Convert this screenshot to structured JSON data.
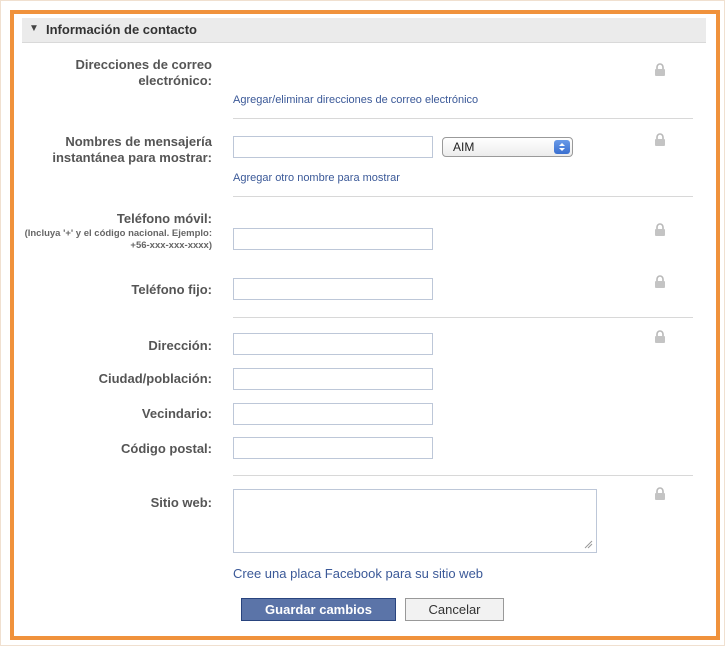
{
  "section": {
    "title": "Información de contacto"
  },
  "email": {
    "label": "Direcciones de correo electrónico:",
    "link": "Agregar/eliminar direcciones de correo electrónico"
  },
  "im": {
    "label": "Nombres de mensajería instantánea para mostrar:",
    "selected_service": "AIM",
    "link": "Agregar otro nombre para mostrar",
    "value": ""
  },
  "mobile": {
    "label": "Teléfono móvil:",
    "hint": "(Incluya '+' y el código nacional. Ejemplo: +56-xxx-xxx-xxxx)",
    "value": ""
  },
  "landline": {
    "label": "Teléfono fijo:",
    "value": ""
  },
  "address": {
    "label": "Dirección:",
    "value": ""
  },
  "city": {
    "label": "Ciudad/población:",
    "value": ""
  },
  "neighborhood": {
    "label": "Vecindario:",
    "value": ""
  },
  "zip": {
    "label": "Código postal:",
    "value": ""
  },
  "website": {
    "label": "Sitio web:",
    "link": "Cree una placa Facebook para su sitio web",
    "value": ""
  },
  "buttons": {
    "save": "Guardar cambios",
    "cancel": "Cancelar"
  },
  "colors": {
    "frame_accent": "#f0923c",
    "link": "#3b5998",
    "primary_button": "#5b74a8"
  },
  "icons": {
    "lock": "lock-icon",
    "collapse": "triangle-down-icon"
  }
}
